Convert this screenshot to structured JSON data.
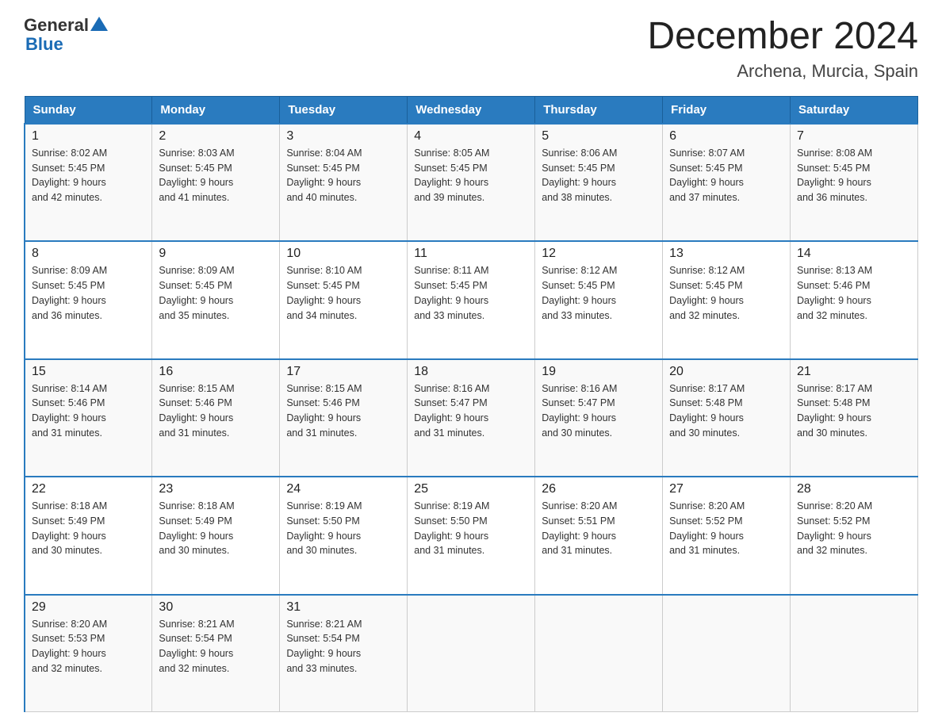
{
  "header": {
    "logo": {
      "text_general": "General",
      "text_blue": "Blue"
    },
    "title": "December 2024",
    "location": "Archena, Murcia, Spain"
  },
  "weekdays": [
    "Sunday",
    "Monday",
    "Tuesday",
    "Wednesday",
    "Thursday",
    "Friday",
    "Saturday"
  ],
  "weeks": [
    [
      {
        "day": "1",
        "sunrise": "Sunrise: 8:02 AM",
        "sunset": "Sunset: 5:45 PM",
        "daylight": "Daylight: 9 hours",
        "daylight2": "and 42 minutes."
      },
      {
        "day": "2",
        "sunrise": "Sunrise: 8:03 AM",
        "sunset": "Sunset: 5:45 PM",
        "daylight": "Daylight: 9 hours",
        "daylight2": "and 41 minutes."
      },
      {
        "day": "3",
        "sunrise": "Sunrise: 8:04 AM",
        "sunset": "Sunset: 5:45 PM",
        "daylight": "Daylight: 9 hours",
        "daylight2": "and 40 minutes."
      },
      {
        "day": "4",
        "sunrise": "Sunrise: 8:05 AM",
        "sunset": "Sunset: 5:45 PM",
        "daylight": "Daylight: 9 hours",
        "daylight2": "and 39 minutes."
      },
      {
        "day": "5",
        "sunrise": "Sunrise: 8:06 AM",
        "sunset": "Sunset: 5:45 PM",
        "daylight": "Daylight: 9 hours",
        "daylight2": "and 38 minutes."
      },
      {
        "day": "6",
        "sunrise": "Sunrise: 8:07 AM",
        "sunset": "Sunset: 5:45 PM",
        "daylight": "Daylight: 9 hours",
        "daylight2": "and 37 minutes."
      },
      {
        "day": "7",
        "sunrise": "Sunrise: 8:08 AM",
        "sunset": "Sunset: 5:45 PM",
        "daylight": "Daylight: 9 hours",
        "daylight2": "and 36 minutes."
      }
    ],
    [
      {
        "day": "8",
        "sunrise": "Sunrise: 8:09 AM",
        "sunset": "Sunset: 5:45 PM",
        "daylight": "Daylight: 9 hours",
        "daylight2": "and 36 minutes."
      },
      {
        "day": "9",
        "sunrise": "Sunrise: 8:09 AM",
        "sunset": "Sunset: 5:45 PM",
        "daylight": "Daylight: 9 hours",
        "daylight2": "and 35 minutes."
      },
      {
        "day": "10",
        "sunrise": "Sunrise: 8:10 AM",
        "sunset": "Sunset: 5:45 PM",
        "daylight": "Daylight: 9 hours",
        "daylight2": "and 34 minutes."
      },
      {
        "day": "11",
        "sunrise": "Sunrise: 8:11 AM",
        "sunset": "Sunset: 5:45 PM",
        "daylight": "Daylight: 9 hours",
        "daylight2": "and 33 minutes."
      },
      {
        "day": "12",
        "sunrise": "Sunrise: 8:12 AM",
        "sunset": "Sunset: 5:45 PM",
        "daylight": "Daylight: 9 hours",
        "daylight2": "and 33 minutes."
      },
      {
        "day": "13",
        "sunrise": "Sunrise: 8:12 AM",
        "sunset": "Sunset: 5:45 PM",
        "daylight": "Daylight: 9 hours",
        "daylight2": "and 32 minutes."
      },
      {
        "day": "14",
        "sunrise": "Sunrise: 8:13 AM",
        "sunset": "Sunset: 5:46 PM",
        "daylight": "Daylight: 9 hours",
        "daylight2": "and 32 minutes."
      }
    ],
    [
      {
        "day": "15",
        "sunrise": "Sunrise: 8:14 AM",
        "sunset": "Sunset: 5:46 PM",
        "daylight": "Daylight: 9 hours",
        "daylight2": "and 31 minutes."
      },
      {
        "day": "16",
        "sunrise": "Sunrise: 8:15 AM",
        "sunset": "Sunset: 5:46 PM",
        "daylight": "Daylight: 9 hours",
        "daylight2": "and 31 minutes."
      },
      {
        "day": "17",
        "sunrise": "Sunrise: 8:15 AM",
        "sunset": "Sunset: 5:46 PM",
        "daylight": "Daylight: 9 hours",
        "daylight2": "and 31 minutes."
      },
      {
        "day": "18",
        "sunrise": "Sunrise: 8:16 AM",
        "sunset": "Sunset: 5:47 PM",
        "daylight": "Daylight: 9 hours",
        "daylight2": "and 31 minutes."
      },
      {
        "day": "19",
        "sunrise": "Sunrise: 8:16 AM",
        "sunset": "Sunset: 5:47 PM",
        "daylight": "Daylight: 9 hours",
        "daylight2": "and 30 minutes."
      },
      {
        "day": "20",
        "sunrise": "Sunrise: 8:17 AM",
        "sunset": "Sunset: 5:48 PM",
        "daylight": "Daylight: 9 hours",
        "daylight2": "and 30 minutes."
      },
      {
        "day": "21",
        "sunrise": "Sunrise: 8:17 AM",
        "sunset": "Sunset: 5:48 PM",
        "daylight": "Daylight: 9 hours",
        "daylight2": "and 30 minutes."
      }
    ],
    [
      {
        "day": "22",
        "sunrise": "Sunrise: 8:18 AM",
        "sunset": "Sunset: 5:49 PM",
        "daylight": "Daylight: 9 hours",
        "daylight2": "and 30 minutes."
      },
      {
        "day": "23",
        "sunrise": "Sunrise: 8:18 AM",
        "sunset": "Sunset: 5:49 PM",
        "daylight": "Daylight: 9 hours",
        "daylight2": "and 30 minutes."
      },
      {
        "day": "24",
        "sunrise": "Sunrise: 8:19 AM",
        "sunset": "Sunset: 5:50 PM",
        "daylight": "Daylight: 9 hours",
        "daylight2": "and 30 minutes."
      },
      {
        "day": "25",
        "sunrise": "Sunrise: 8:19 AM",
        "sunset": "Sunset: 5:50 PM",
        "daylight": "Daylight: 9 hours",
        "daylight2": "and 31 minutes."
      },
      {
        "day": "26",
        "sunrise": "Sunrise: 8:20 AM",
        "sunset": "Sunset: 5:51 PM",
        "daylight": "Daylight: 9 hours",
        "daylight2": "and 31 minutes."
      },
      {
        "day": "27",
        "sunrise": "Sunrise: 8:20 AM",
        "sunset": "Sunset: 5:52 PM",
        "daylight": "Daylight: 9 hours",
        "daylight2": "and 31 minutes."
      },
      {
        "day": "28",
        "sunrise": "Sunrise: 8:20 AM",
        "sunset": "Sunset: 5:52 PM",
        "daylight": "Daylight: 9 hours",
        "daylight2": "and 32 minutes."
      }
    ],
    [
      {
        "day": "29",
        "sunrise": "Sunrise: 8:20 AM",
        "sunset": "Sunset: 5:53 PM",
        "daylight": "Daylight: 9 hours",
        "daylight2": "and 32 minutes."
      },
      {
        "day": "30",
        "sunrise": "Sunrise: 8:21 AM",
        "sunset": "Sunset: 5:54 PM",
        "daylight": "Daylight: 9 hours",
        "daylight2": "and 32 minutes."
      },
      {
        "day": "31",
        "sunrise": "Sunrise: 8:21 AM",
        "sunset": "Sunset: 5:54 PM",
        "daylight": "Daylight: 9 hours",
        "daylight2": "and 33 minutes."
      },
      null,
      null,
      null,
      null
    ]
  ]
}
